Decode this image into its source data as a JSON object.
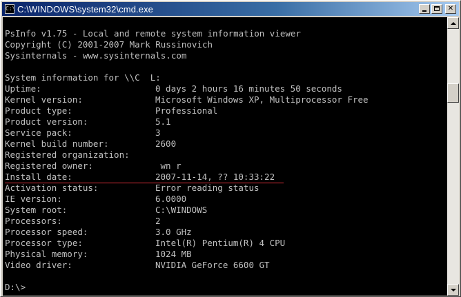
{
  "window": {
    "title": "C:\\WINDOWS\\system32\\cmd.exe",
    "icon_name": "console-app-icon",
    "icon_glyph": "C:\\"
  },
  "titlebar_buttons": {
    "minimize": "minimize-icon",
    "maximize": "maximize-icon",
    "close_glyph": "✕"
  },
  "colors": {
    "console_bg": "#000000",
    "console_text": "#c0c0c0",
    "annotation_underline": "#e0303a"
  },
  "console": {
    "header": [
      "PsInfo v1.75 - Local and remote system information viewer",
      "Copyright (C) 2001-2007 Mark Russinovich",
      "Sysinternals - www.sysinternals.com"
    ],
    "system_info_label": "System information for \\\\C  L:",
    "rows": [
      {
        "label": "Uptime:",
        "value": "0 days 2 hours 16 minutes 50 seconds"
      },
      {
        "label": "Kernel version:",
        "value": "Microsoft Windows XP, Multiprocessor Free"
      },
      {
        "label": "Product type:",
        "value": "Professional"
      },
      {
        "label": "Product version:",
        "value": "5.1"
      },
      {
        "label": "Service pack:",
        "value": "3"
      },
      {
        "label": "Kernel build number:",
        "value": "2600"
      },
      {
        "label": "Registered organization:",
        "value": ""
      },
      {
        "label": "Registered owner:",
        "value": " wn r"
      },
      {
        "label": "Install date:",
        "value": "2007-11-14, ?? 10:33:22"
      },
      {
        "label": "Activation status:",
        "value": "Error reading status"
      },
      {
        "label": "IE version:",
        "value": "6.0000"
      },
      {
        "label": "System root:",
        "value": "C:\\WINDOWS"
      },
      {
        "label": "Processors:",
        "value": "2"
      },
      {
        "label": "Processor speed:",
        "value": "3.0 GHz"
      },
      {
        "label": "Processor type:",
        "value": "Intel(R) Pentium(R) 4 CPU"
      },
      {
        "label": "Physical memory:",
        "value": "1024 MB"
      },
      {
        "label": "Video driver:",
        "value": "NVIDIA GeForce 6600 GT"
      }
    ],
    "prompt": "D:\\>"
  },
  "scrollbar": {
    "up_icon": "scroll-up-arrow-icon",
    "down_icon": "scroll-down-arrow-icon"
  }
}
